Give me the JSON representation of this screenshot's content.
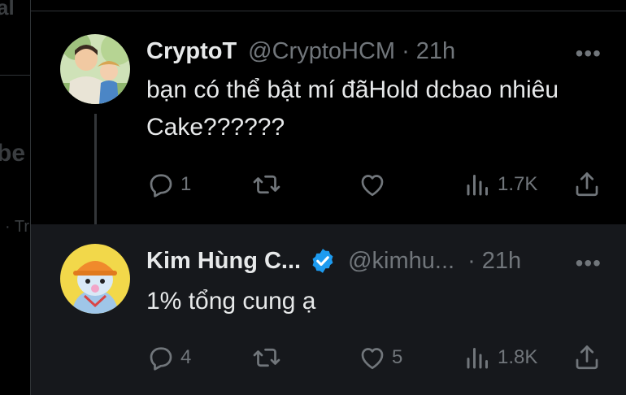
{
  "background_fragments": {
    "frag1": "al",
    "frag2": "be",
    "frag3": "· Tr"
  },
  "tweets": [
    {
      "name": "CryptoT",
      "handle": "@CryptoHCM",
      "separator": "·",
      "time": "21h",
      "text": "bạn có thể bật mí đãHold dcbao nhiêu Cake??????",
      "replies": "1",
      "retweets": "",
      "likes": "",
      "views": "1.7K",
      "verified": false
    },
    {
      "name": "Kim Hùng C...",
      "handle": "@kimhu...",
      "separator": "·",
      "time": "21h",
      "text": "1% tổng cung ạ",
      "replies": "4",
      "retweets": "",
      "likes": "5",
      "views": "1.8K",
      "verified": true
    }
  ],
  "more_label": "•••",
  "colors": {
    "background": "#000000",
    "reply_bg": "#16181c",
    "text": "#e7e9ea",
    "muted": "#71767b",
    "verified": "#1d9bf0",
    "border": "#2f3336"
  },
  "icons": [
    "reply-icon",
    "retweet-icon",
    "like-icon",
    "views-icon",
    "share-icon",
    "more-icon",
    "verified-badge-icon"
  ]
}
